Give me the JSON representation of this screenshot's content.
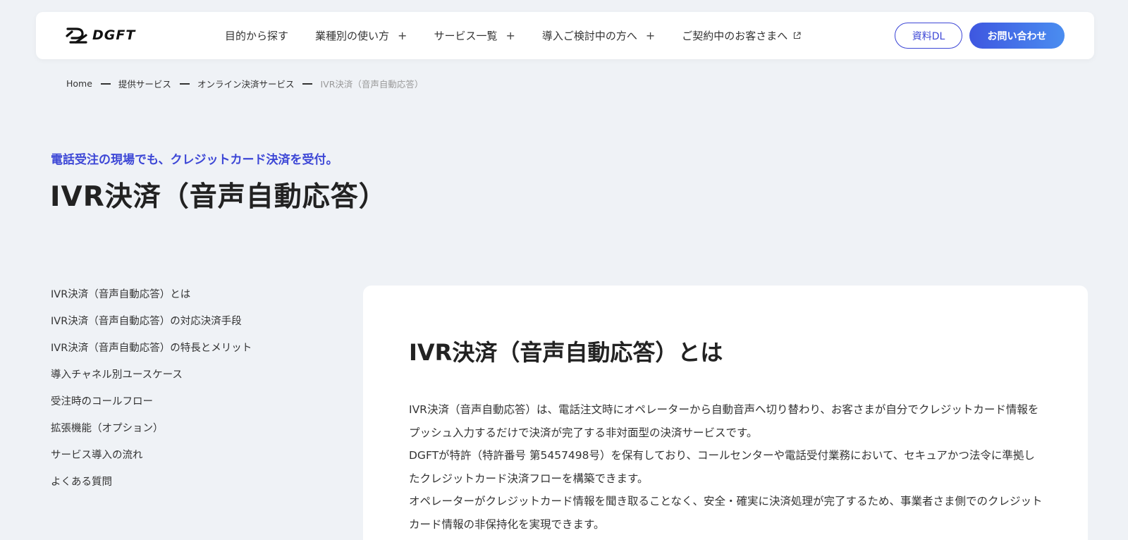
{
  "header": {
    "logo_text": "DGFT",
    "nav": [
      {
        "label": "目的から探す",
        "suffix": ""
      },
      {
        "label": "業種別の使い方",
        "suffix": "+"
      },
      {
        "label": "サービス一覧",
        "suffix": "+"
      },
      {
        "label": "導入ご検討中の方へ",
        "suffix": "+"
      },
      {
        "label": "ご契約中のお客さまへ",
        "suffix": "external-link-icon"
      }
    ],
    "download_label": "資料DL",
    "contact_label": "お問い合わせ",
    "accent_color": "#3d47d6"
  },
  "breadcrumb": [
    "Home",
    "提供サービス",
    "オンライン決済サービス",
    "IVR決済（音声自動応答）"
  ],
  "hero": {
    "kicker": "電話受注の現場でも、クレジットカード決済を受付。",
    "title": "IVR決済（音声自動応答）"
  },
  "toc": [
    "IVR決済（音声自動応答）とは",
    "IVR決済（音声自動応答）の対応決済手段",
    "IVR決済（音声自動応答）の特長とメリット",
    "導入チャネル別ユースケース",
    "受注時のコールフロー",
    "拡張機能（オプション）",
    "サービス導入の流れ",
    "よくある質問"
  ],
  "section": {
    "title": "IVR決済（音声自動応答）とは",
    "paragraphs": [
      "IVR決済（音声自動応答）は、電話注文時にオペレーターから自動音声へ切り替わり、お客さまが自分でクレジットカード情報をプッシュ入力するだけで決済が完了する非対面型の決済サービスです。",
      "DGFTが特許（特許番号 第5457498号）を保有しており、コールセンターや電話受付業務において、セキュアかつ法令に準拠したクレジットカード決済フローを構築できます。",
      "オペレーターがクレジットカード情報を聞き取ることなく、安全・確実に決済処理が完了するため、事業者さま側でのクレジットカード情報の非保持化を実現できます。"
    ]
  }
}
